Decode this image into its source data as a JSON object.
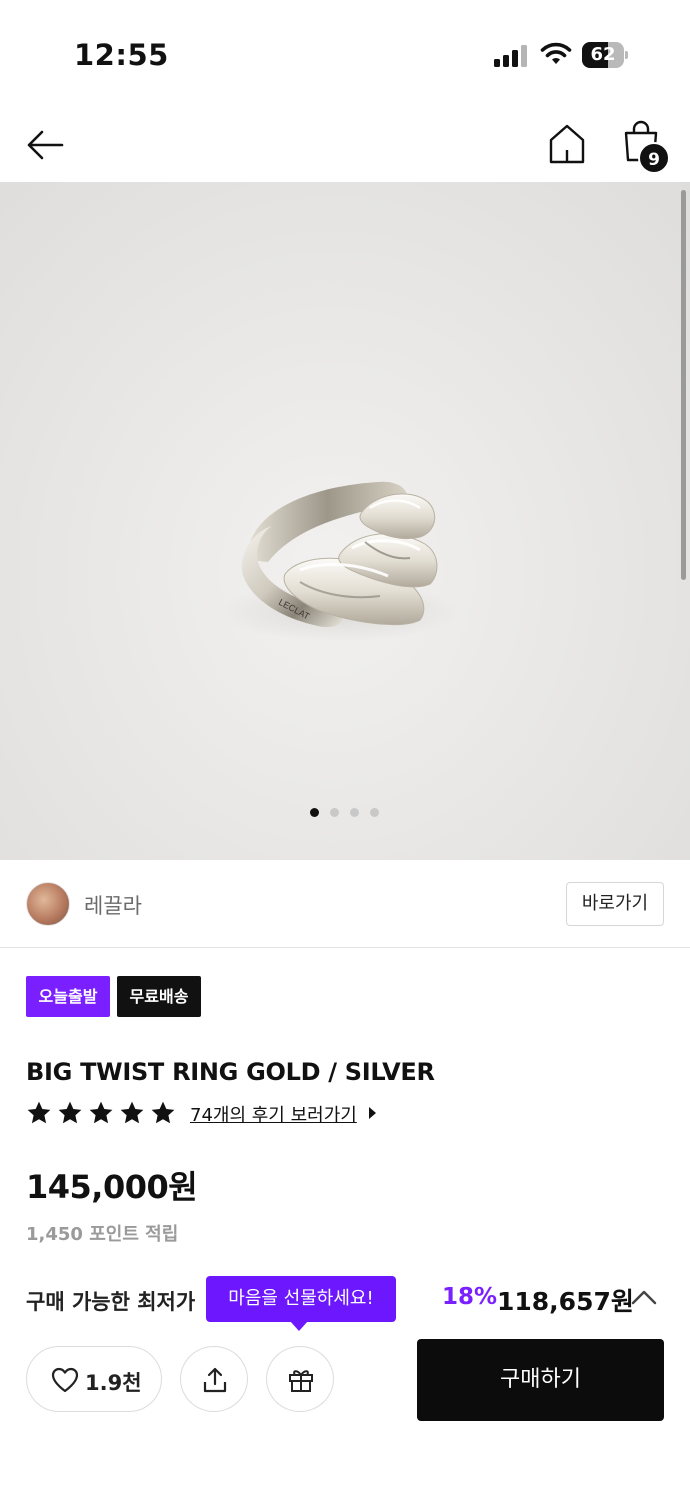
{
  "status_bar": {
    "time": "12:55",
    "battery_level": "62"
  },
  "header": {
    "cart_count": "9"
  },
  "hero": {
    "image_count": 4,
    "active_index": 0,
    "engraving": "LECLAT"
  },
  "brand": {
    "name": "레끌라",
    "goto_label": "바로가기"
  },
  "badges": [
    {
      "label": "오늘출발",
      "color": "#7a1fff"
    },
    {
      "label": "무료배송",
      "color": "#111111"
    }
  ],
  "product": {
    "title": "BIG TWIST RING GOLD / SILVER",
    "rating_stars": 5,
    "review_link": "74개의 후기 보러가기",
    "price": "145,000원",
    "points": "1,450 포인트 적립"
  },
  "lowest_price": {
    "label": "구매 가능한 최저가",
    "gift_tooltip": "마음을 선물하세요!",
    "discount": "18%",
    "price": "118,657원"
  },
  "actions": {
    "like_count": "1.9천",
    "buy_label": "구매하기"
  },
  "colors": {
    "accent": "#7a1fff",
    "primary": "#0c0c0c"
  }
}
